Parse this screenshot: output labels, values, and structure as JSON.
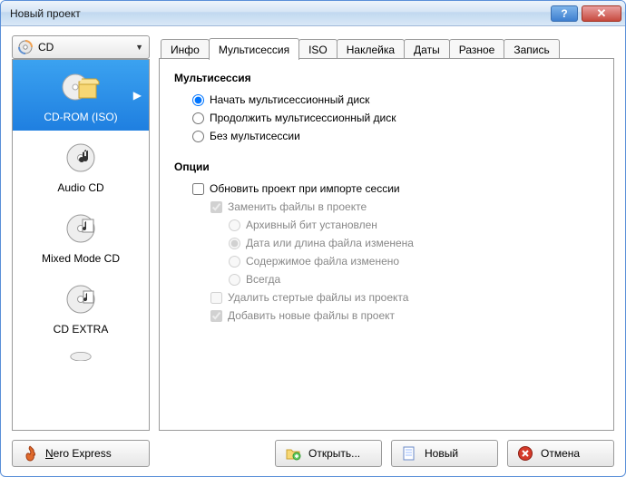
{
  "window": {
    "title": "Новый проект"
  },
  "media_dropdown": {
    "label": "CD"
  },
  "tabs": [
    {
      "label": "Инфо",
      "active": false
    },
    {
      "label": "Мультисессия",
      "active": true
    },
    {
      "label": "ISO",
      "active": false
    },
    {
      "label": "Наклейка",
      "active": false
    },
    {
      "label": "Даты",
      "active": false
    },
    {
      "label": "Разное",
      "active": false
    },
    {
      "label": "Запись",
      "active": false
    }
  ],
  "projects": [
    {
      "label": "CD-ROM (ISO)",
      "selected": true
    },
    {
      "label": "Audio CD",
      "selected": false
    },
    {
      "label": "Mixed Mode CD",
      "selected": false
    },
    {
      "label": "CD EXTRA",
      "selected": false
    }
  ],
  "section_multisession": {
    "title": "Мультисессия",
    "options": {
      "start": "Начать мультисессионный диск",
      "continue": "Продолжить мультисессионный диск",
      "none": "Без мультисессии"
    },
    "selected": "start"
  },
  "section_options": {
    "title": "Опции",
    "update_project": {
      "label": "Обновить проект при импорте сессии",
      "checked": false
    },
    "replace_files": {
      "label": "Заменить файлы в проекте",
      "checked": true,
      "disabled": true
    },
    "criteria": {
      "archive_bit": "Архивный бит установлен",
      "date_length": "Дата или длина файла изменена",
      "content": "Содержимое файла изменено",
      "always": "Всегда",
      "selected": "date_length"
    },
    "delete_erased": {
      "label": "Удалить стертые файлы из проекта",
      "checked": false,
      "disabled": true
    },
    "add_new": {
      "label": "Добавить новые файлы в проект",
      "checked": true,
      "disabled": true
    }
  },
  "footer": {
    "express": "Nero Express",
    "open": "Открыть...",
    "new": "Новый",
    "cancel": "Отмена"
  }
}
